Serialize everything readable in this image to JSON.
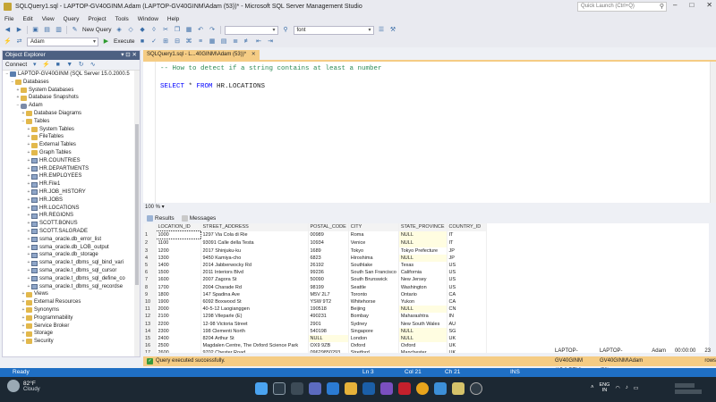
{
  "window": {
    "title": "SQLQuery1.sql - LAPTOP-GV40GINM.Adam (LAPTOP-GV40GINM\\Adam (53))* - Microsoft SQL Server Management Studio",
    "quick_launch_placeholder": "Quick Launch (Ctrl+Q)"
  },
  "menu": [
    "File",
    "Edit",
    "View",
    "Query",
    "Project",
    "Tools",
    "Window",
    "Help"
  ],
  "toolbar": {
    "new_query": "New Query",
    "execute": "Execute",
    "database": "Adam",
    "font_combo": "font"
  },
  "object_explorer": {
    "title": "Object Explorer",
    "connect": "Connect",
    "nodes": [
      {
        "label": "LAPTOP-GV40GINM (SQL Server 15.0.2000.5",
        "indent": 0,
        "icon": "srv",
        "exp": "−"
      },
      {
        "label": "Databases",
        "indent": 1,
        "icon": "fold",
        "exp": "−"
      },
      {
        "label": "System Databases",
        "indent": 2,
        "icon": "fold",
        "exp": "+"
      },
      {
        "label": "Database Snapshots",
        "indent": 2,
        "icon": "fold",
        "exp": "+"
      },
      {
        "label": "Adam",
        "indent": 2,
        "icon": "db",
        "exp": "−"
      },
      {
        "label": "Database Diagrams",
        "indent": 3,
        "icon": "fold",
        "exp": "+"
      },
      {
        "label": "Tables",
        "indent": 3,
        "icon": "fold",
        "exp": "−"
      },
      {
        "label": "System Tables",
        "indent": 4,
        "icon": "fold",
        "exp": "+"
      },
      {
        "label": "FileTables",
        "indent": 4,
        "icon": "fold",
        "exp": "+"
      },
      {
        "label": "External Tables",
        "indent": 4,
        "icon": "fold",
        "exp": "+"
      },
      {
        "label": "Graph Tables",
        "indent": 4,
        "icon": "fold",
        "exp": "+"
      },
      {
        "label": "HR.COUNTRIES",
        "indent": 4,
        "icon": "tbl",
        "exp": "+"
      },
      {
        "label": "HR.DEPARTMENTS",
        "indent": 4,
        "icon": "tbl",
        "exp": "+"
      },
      {
        "label": "HR.EMPLOYEES",
        "indent": 4,
        "icon": "tbl",
        "exp": "+"
      },
      {
        "label": "HR.File1",
        "indent": 4,
        "icon": "tbl",
        "exp": "+"
      },
      {
        "label": "HR.JOB_HISTORY",
        "indent": 4,
        "icon": "tbl",
        "exp": "+"
      },
      {
        "label": "HR.JOBS",
        "indent": 4,
        "icon": "tbl",
        "exp": "+"
      },
      {
        "label": "HR.LOCATIONS",
        "indent": 4,
        "icon": "tbl",
        "exp": "+"
      },
      {
        "label": "HR.REGIONS",
        "indent": 4,
        "icon": "tbl",
        "exp": "+"
      },
      {
        "label": "SCOTT.BONUS",
        "indent": 4,
        "icon": "tbl",
        "exp": "+"
      },
      {
        "label": "SCOTT.SALGRADE",
        "indent": 4,
        "icon": "tbl",
        "exp": "+"
      },
      {
        "label": "ssma_oracle.db_error_list",
        "indent": 4,
        "icon": "tbl",
        "exp": "+"
      },
      {
        "label": "ssma_oracle.db_LOB_output",
        "indent": 4,
        "icon": "tbl",
        "exp": "+"
      },
      {
        "label": "ssma_oracle.db_storage",
        "indent": 4,
        "icon": "tbl",
        "exp": "+"
      },
      {
        "label": "ssma_oracle.t_dbms_sql_bind_vari",
        "indent": 4,
        "icon": "tbl",
        "exp": "+"
      },
      {
        "label": "ssma_oracle.t_dbms_sql_cursor",
        "indent": 4,
        "icon": "tbl",
        "exp": "+"
      },
      {
        "label": "ssma_oracle.t_dbms_sql_define_co",
        "indent": 4,
        "icon": "tbl",
        "exp": "+"
      },
      {
        "label": "ssma_oracle.t_dbms_sql_recordse",
        "indent": 4,
        "icon": "tbl",
        "exp": "+"
      },
      {
        "label": "Views",
        "indent": 3,
        "icon": "fold",
        "exp": "+"
      },
      {
        "label": "External Resources",
        "indent": 3,
        "icon": "fold",
        "exp": "+"
      },
      {
        "label": "Synonyms",
        "indent": 3,
        "icon": "fold",
        "exp": "+"
      },
      {
        "label": "Programmability",
        "indent": 3,
        "icon": "fold",
        "exp": "+"
      },
      {
        "label": "Service Broker",
        "indent": 3,
        "icon": "fold",
        "exp": "+"
      },
      {
        "label": "Storage",
        "indent": 3,
        "icon": "fold",
        "exp": "+"
      },
      {
        "label": "Security",
        "indent": 3,
        "icon": "fold",
        "exp": "+"
      }
    ]
  },
  "editor": {
    "tab_label": "SQLQuery1.sql - L...40GINM\\Adam (53))*",
    "line1": "-- How to detect if a string contains at least a number",
    "line2_kw": "SELECT",
    "line2_star": " * ",
    "line2_kw2": "FROM",
    "line2_rest": " HR.LOCATIONS",
    "zoom": "100 %"
  },
  "results": {
    "tab_results": "Results",
    "tab_messages": "Messages",
    "columns": [
      "LOCATION_ID",
      "STREET_ADDRESS",
      "POSTAL_CODE",
      "CITY",
      "STATE_PROVINCE",
      "COUNTRY_ID"
    ],
    "rows": [
      [
        "1",
        "1000",
        "1297 Via Cola di Rie",
        "00989",
        "Roma",
        "NULL",
        "IT"
      ],
      [
        "2",
        "1100",
        "93091 Calle della Testa",
        "10934",
        "Venice",
        "NULL",
        "IT"
      ],
      [
        "3",
        "1200",
        "2017 Shinjuku-ku",
        "1689",
        "Tokyo",
        "Tokyo Prefecture",
        "JP"
      ],
      [
        "4",
        "1300",
        "9450 Kamiya-cho",
        "6823",
        "Hiroshima",
        "NULL",
        "JP"
      ],
      [
        "5",
        "1400",
        "2014 Jabberwocky Rd",
        "26192",
        "Southlake",
        "Texas",
        "US"
      ],
      [
        "6",
        "1500",
        "2011 Interiors Blvd",
        "99236",
        "South San Francisco",
        "California",
        "US"
      ],
      [
        "7",
        "1600",
        "2007 Zagora St",
        "50090",
        "South Brunswick",
        "New Jersey",
        "US"
      ],
      [
        "8",
        "1700",
        "2004 Charade Rd",
        "98199",
        "Seattle",
        "Washington",
        "US"
      ],
      [
        "9",
        "1800",
        "147 Spadina Ave",
        "M5V 2L7",
        "Toronto",
        "Ontario",
        "CA"
      ],
      [
        "10",
        "1900",
        "6092 Boxwood St",
        "YSW 9T2",
        "Whitehorse",
        "Yukon",
        "CA"
      ],
      [
        "11",
        "2000",
        "40-5-12 Laogianggen",
        "190518",
        "Beijing",
        "NULL",
        "CN"
      ],
      [
        "12",
        "2100",
        "1298 Vileparle (E)",
        "490231",
        "Bombay",
        "Maharashtra",
        "IN"
      ],
      [
        "13",
        "2200",
        "12-98 Victoria Street",
        "2901",
        "Sydney",
        "New South Wales",
        "AU"
      ],
      [
        "14",
        "2300",
        "198 Clementi North",
        "540198",
        "Singapore",
        "NULL",
        "SG"
      ],
      [
        "15",
        "2400",
        "8204 Arthur St",
        "NULL",
        "London",
        "NULL",
        "UK"
      ],
      [
        "16",
        "2500",
        "Magdalen Centre, The Oxford Science Park",
        "OX9 9ZB",
        "Oxford",
        "Oxford",
        "UK"
      ],
      [
        "17",
        "2600",
        "9702 Chester Road",
        "09629850293",
        "Stretford",
        "Manchester",
        "UK"
      ]
    ]
  },
  "query_status": {
    "message": "Query executed successfully.",
    "server": "LAPTOP-GV40GINM (15.0 RTM)",
    "user": "LAPTOP-GV40GINM\\Adam (53)",
    "db": "Adam",
    "elapsed": "00:00:00",
    "rows": "23 rows"
  },
  "statusbar": {
    "ready": "Ready",
    "ln": "Ln 3",
    "col": "Col 21",
    "ch": "Ch 21",
    "mode": "INS"
  },
  "taskbar": {
    "temp": "82°F",
    "weather": "Cloudy",
    "lang1": "ENG",
    "lang2": "IN"
  },
  "colors": {
    "accent": "#1f6fc4",
    "tab_active": "#f5cc84",
    "oe_header": "#4d6082"
  }
}
